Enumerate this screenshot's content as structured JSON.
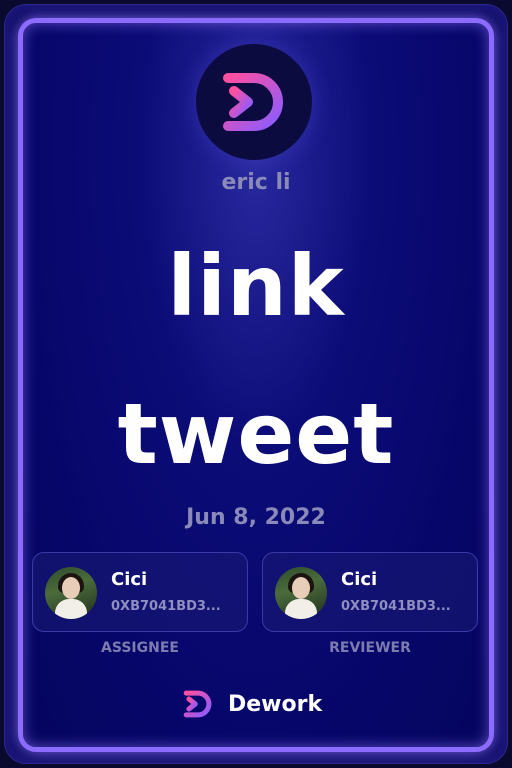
{
  "owner_name": "eric li",
  "task_title_line1": "link",
  "task_title_line2": "tweet",
  "date": "Jun 8, 2022",
  "assignee": {
    "name": "Cici",
    "address": "0XB7041BD3...",
    "role_label": "ASSIGNEE"
  },
  "reviewer": {
    "name": "Cici",
    "address": "0XB7041BD3...",
    "role_label": "REVIEWER"
  },
  "brand": {
    "name": "Dework",
    "logo_icon": "dework-logo-icon"
  },
  "colors": {
    "background": "#05065a",
    "frame_glow": "#8b6cff",
    "logo_gradient_start": "#ff4fa0",
    "logo_gradient_end": "#8a5cff",
    "muted_text": "#8a8ab8",
    "title_text": "#ffffff"
  }
}
